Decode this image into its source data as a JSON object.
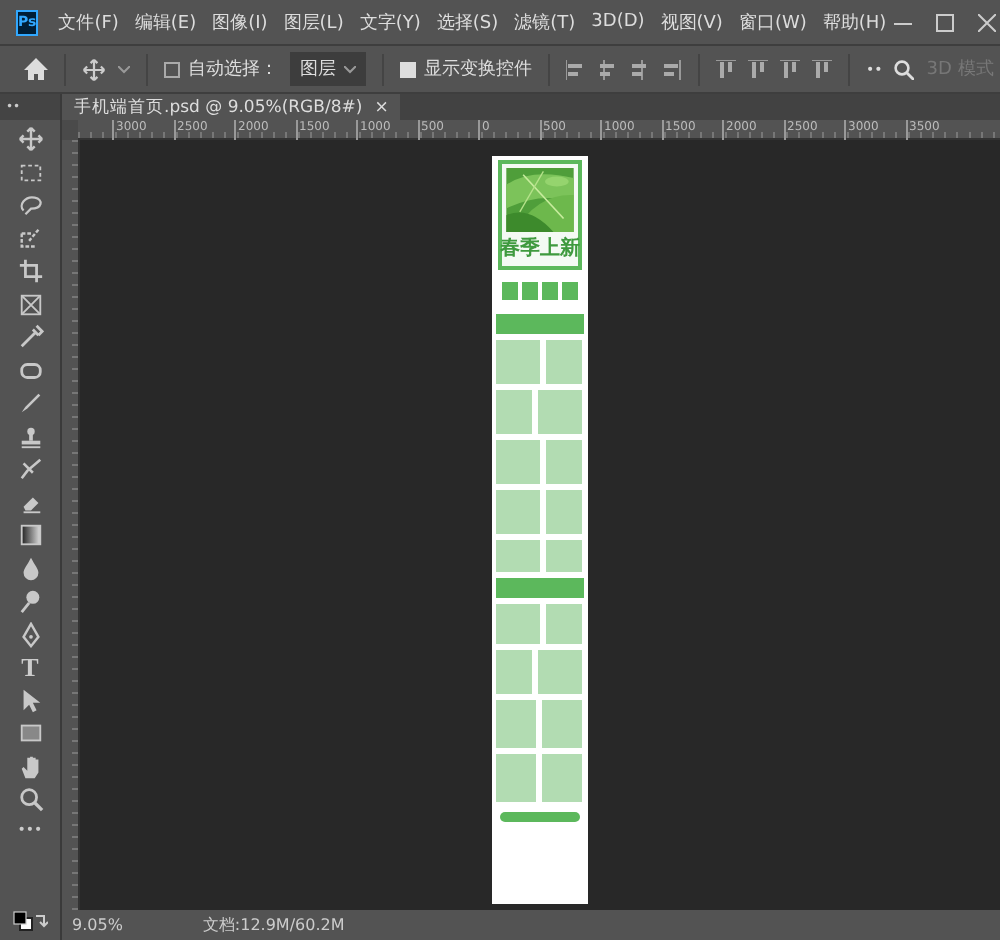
{
  "app": {
    "logo": "Ps"
  },
  "menu": [
    "文件(F)",
    "编辑(E)",
    "图像(I)",
    "图层(L)",
    "文字(Y)",
    "选择(S)",
    "滤镜(T)",
    "3D(D)",
    "视图(V)",
    "窗口(W)",
    "帮助(H)"
  ],
  "options": {
    "auto_select": {
      "label": "自动选择：",
      "checked": false
    },
    "layer_dropdown": "图层",
    "show_transform": {
      "label": "显示变换控件",
      "checked": true
    },
    "more": "••",
    "mode_3d": {
      "label": "3D 模式",
      "disabled": true
    }
  },
  "toolbar_header": "••",
  "document_tab": {
    "title": "手机端首页.psd @ 9.05%(RGB/8#)",
    "close": "×"
  },
  "ruler_labels": [
    "3000",
    "2500",
    "2000",
    "1500",
    "1000",
    "500",
    "0",
    "500",
    "1000",
    "1500",
    "2000",
    "2500",
    "3000",
    "3500"
  ],
  "tools": [
    {
      "kind": "move"
    },
    {
      "kind": "marquee"
    },
    {
      "kind": "lasso"
    },
    {
      "kind": "quick-select"
    },
    {
      "kind": "crop"
    },
    {
      "kind": "frame"
    },
    {
      "kind": "eyedropper"
    },
    {
      "kind": "healing"
    },
    {
      "kind": "brush"
    },
    {
      "kind": "stamp"
    },
    {
      "kind": "history"
    },
    {
      "kind": "eraser"
    },
    {
      "kind": "gradient"
    },
    {
      "kind": "blur"
    },
    {
      "kind": "dodge"
    },
    {
      "kind": "pen"
    },
    {
      "kind": "type",
      "glyph": "T"
    },
    {
      "kind": "path-select"
    },
    {
      "kind": "rectangle"
    },
    {
      "kind": "hand"
    },
    {
      "kind": "zoom"
    },
    {
      "kind": "more",
      "glyph": "•••"
    }
  ],
  "mockup": {
    "banner_title": "春季上新"
  },
  "status": {
    "zoom": "9.05%",
    "doc_info": "文档:12.9M/60.2M"
  }
}
